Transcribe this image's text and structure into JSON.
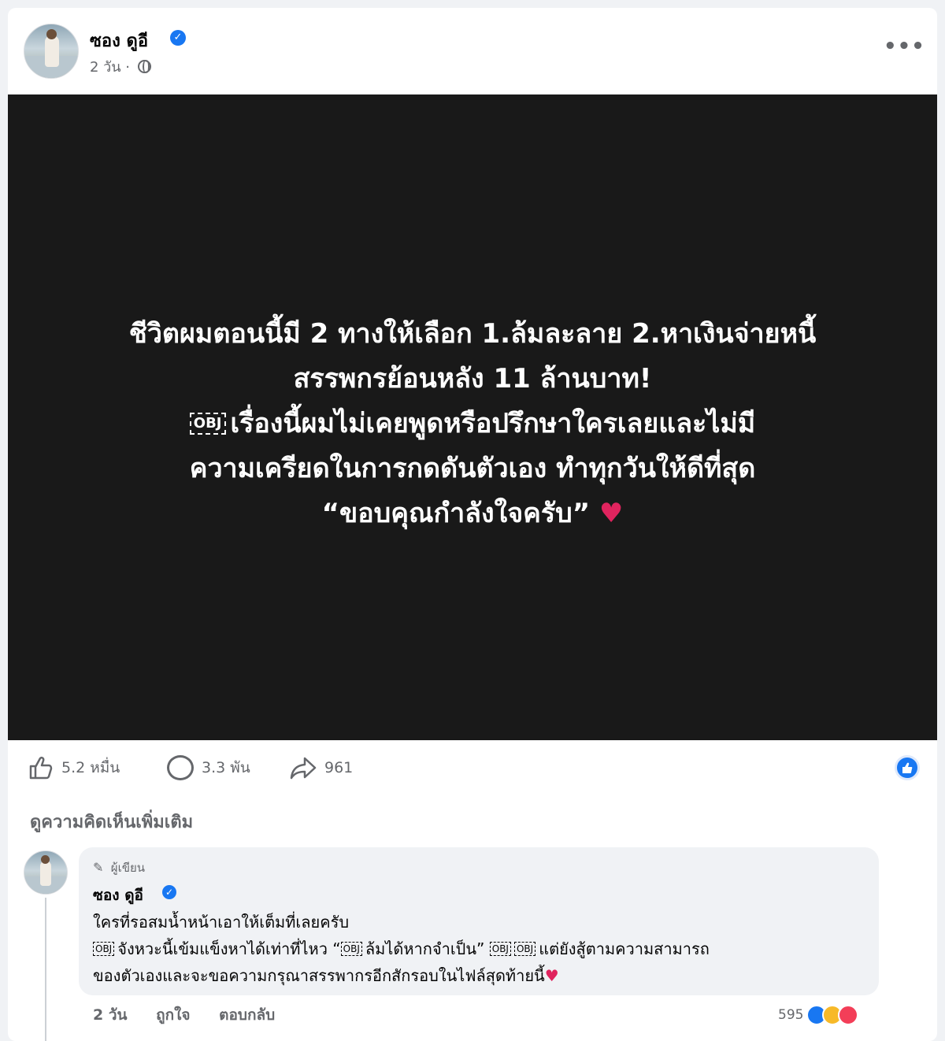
{
  "post": {
    "author": "ซอง ดูอี",
    "time": "2 วัน ·",
    "more_label": "•••",
    "image_text": {
      "line1": "ชีวิตผมตอนนี้มี 2 ทางให้เลือก 1.ล้มละลาย 2.หาเงินจ่ายหนี้",
      "line2": "สรรพกรย้อนหลัง 11 ล้านบาท!",
      "obj": "OBJ",
      "line3": "เรื่องนี้ผมไม่เคยพูดหรือปรึกษาใครเลยและไม่มี",
      "line4": "ความเครียดในการกดดันตัวเอง ทำทุกวันให้ดีที่สุด",
      "line5": "“ขอบคุณกำลังใจครับ”",
      "heart": "♥"
    },
    "stats": {
      "likes": "5.2 หมื่น",
      "comments": "3.3 พัน",
      "shares": "961"
    },
    "view_more_comments": "ดูความคิดเห็นเพิ่มเติม"
  },
  "comment": {
    "badge": "ผู้เขียน",
    "author": "ซอง ดูอี",
    "line1": "ใครที่รอสมน้ำหน้าเอาให้เต็มที่เลยครับ",
    "obj": "OBJ",
    "line2a": "จังหวะนี้เข้มแข็งหาได้เท่าที่ไหว “",
    "line2b": "ล้มได้หากจำเป็น”",
    "line2c": "แต่ยังสู้ตามความสามารถ",
    "line3": "ของตัวเองและจะขอความกรุณาสรรพากรอีกสักรอบในไฟล์สุดท้ายนี้",
    "heart": "♥",
    "time": "2 วัน",
    "like_action": "ถูกใจ",
    "reply_action": "ตอบกลับ",
    "reaction_count": "595"
  },
  "colors": {
    "brand_blue": "#1877f2",
    "heart_red": "#e0245e",
    "care_yellow": "#f7b928",
    "love_red": "#f33e58"
  }
}
